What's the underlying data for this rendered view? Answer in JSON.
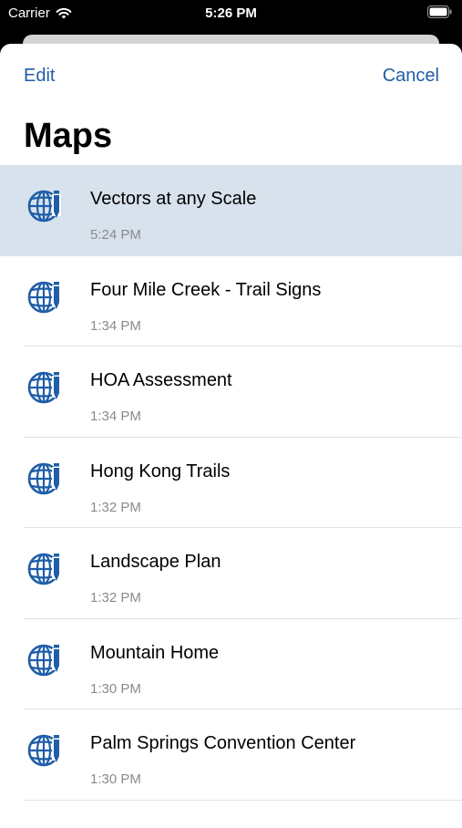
{
  "status_bar": {
    "carrier": "Carrier",
    "time": "5:26 PM"
  },
  "nav": {
    "edit_label": "Edit",
    "cancel_label": "Cancel",
    "title": "Maps"
  },
  "maps": [
    {
      "name": "Vectors at any Scale",
      "time": "5:24 PM",
      "selected": true
    },
    {
      "name": "Four Mile Creek - Trail Signs",
      "time": "1:34 PM"
    },
    {
      "name": "HOA Assessment",
      "time": "1:34 PM"
    },
    {
      "name": "Hong Kong Trails",
      "time": "1:32 PM"
    },
    {
      "name": "Landscape Plan",
      "time": "1:32 PM"
    },
    {
      "name": "Mountain Home",
      "time": "1:30 PM"
    },
    {
      "name": "Palm Springs Convention Center",
      "time": "1:30 PM"
    }
  ],
  "colors": {
    "accent": "#1f5ea8",
    "selected_row": "#d8e2ec",
    "secondary_text": "#8a8a8e"
  },
  "icons": {
    "map_item": "globe-with-pencil-icon",
    "wifi": "wifi-icon",
    "battery": "battery-icon"
  }
}
